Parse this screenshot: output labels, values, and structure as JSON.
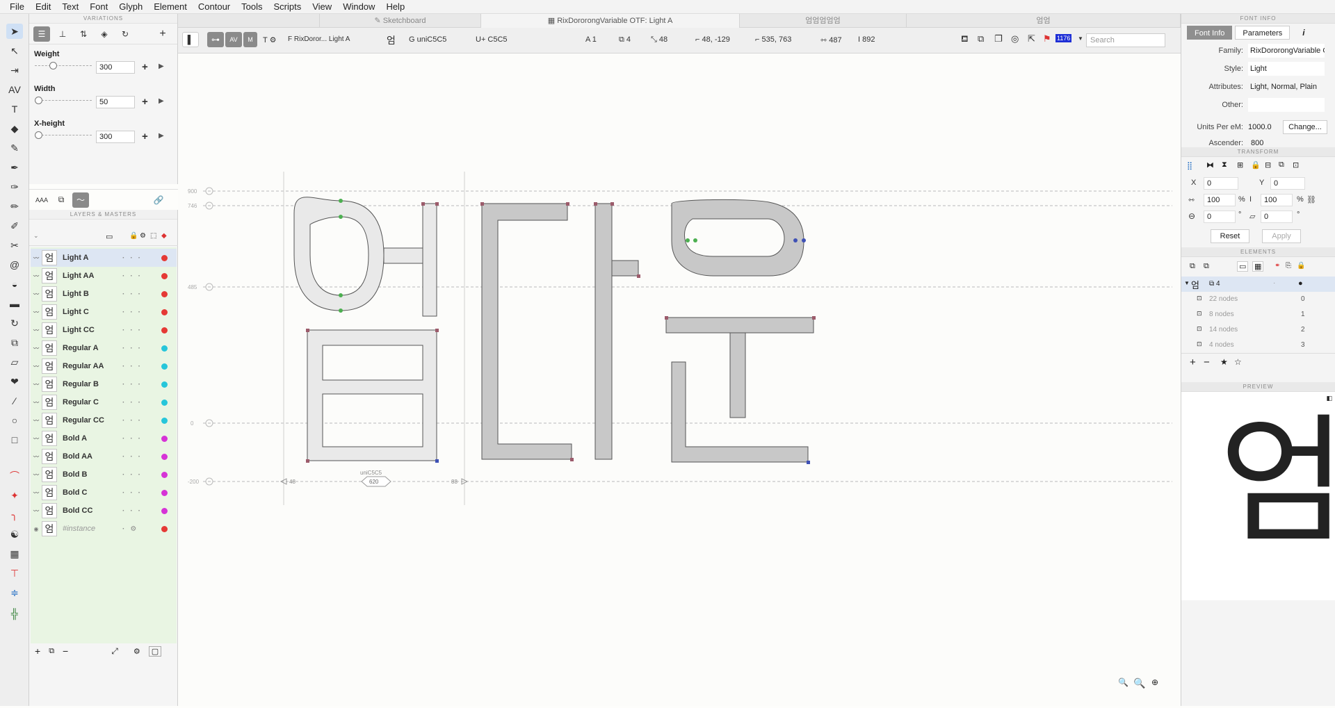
{
  "menu": [
    "File",
    "Edit",
    "Text",
    "Font",
    "Glyph",
    "Element",
    "Contour",
    "Tools",
    "Scripts",
    "View",
    "Window",
    "Help"
  ],
  "variations": {
    "title": "VARIATIONS",
    "axes": [
      {
        "name": "Weight",
        "value": "300",
        "thumb": 0.3
      },
      {
        "name": "Width",
        "value": "50",
        "thumb": 0.0
      },
      {
        "name": "X-height",
        "value": "300",
        "thumb": 0.0
      }
    ]
  },
  "layers": {
    "title": "LAYERS & MASTERS",
    "items": [
      {
        "name": "Light A",
        "glyph": "엄",
        "color": "#e53935"
      },
      {
        "name": "Light AA",
        "glyph": "엄",
        "color": "#e53935"
      },
      {
        "name": "Light B",
        "glyph": "엄",
        "color": "#e53935"
      },
      {
        "name": "Light C",
        "glyph": "엄",
        "color": "#e53935"
      },
      {
        "name": "Light CC",
        "glyph": "엄",
        "color": "#e53935"
      },
      {
        "name": "Regular A",
        "glyph": "엄",
        "color": "#26c6da"
      },
      {
        "name": "Regular AA",
        "glyph": "엄",
        "color": "#26c6da"
      },
      {
        "name": "Regular B",
        "glyph": "엄",
        "color": "#26c6da"
      },
      {
        "name": "Regular C",
        "glyph": "엄",
        "color": "#26c6da"
      },
      {
        "name": "Regular CC",
        "glyph": "엄",
        "color": "#26c6da"
      },
      {
        "name": "Bold A",
        "glyph": "엄",
        "color": "#d633d6"
      },
      {
        "name": "Bold AA",
        "glyph": "엄",
        "color": "#d633d6"
      },
      {
        "name": "Bold B",
        "glyph": "엄",
        "color": "#d633d6"
      },
      {
        "name": "Bold C",
        "glyph": "엄",
        "color": "#d633d6"
      },
      {
        "name": "Bold CC",
        "glyph": "엄",
        "color": "#d633d6"
      },
      {
        "name": "#instance",
        "glyph": "엄",
        "color": "#e53935"
      }
    ]
  },
  "tabs": {
    "sketchboard": "Sketchboard",
    "document": "RixDororongVariable OTF: Light A",
    "glyphs": "엄엄엄엄엄",
    "extra": "엄엄"
  },
  "info": {
    "font": "F RixDoror... Light A",
    "glyph": "G uniC5C5",
    "unicode": "U+ C5C5",
    "layer": "A 1",
    "contours": "4",
    "nodes": "48",
    "position": "48, -129",
    "size": "535, 763",
    "width": "487",
    "height": "892",
    "highlight": "1176",
    "search_placeholder": "Search"
  },
  "canvas": {
    "metric_labels": [
      "900",
      "746",
      "485",
      "0",
      "-200"
    ],
    "glyph_label": "uniC5C5",
    "advance": "620",
    "lsb": "48",
    "rsb": "88"
  },
  "font_info": {
    "title": "FONT INFO",
    "tab_font": "Font Info",
    "tab_params": "Parameters",
    "family_label": "Family:",
    "family": "RixDororongVariable OT",
    "style_label": "Style:",
    "style": "Light",
    "attr_label": "Attributes:",
    "attributes": "Light, Normal, Plain",
    "other_label": "Other:",
    "other": "",
    "upm_label": "Units Per eM:",
    "upm": "1000.0",
    "change": "Change...",
    "ascender_label": "Ascender:",
    "ascender": "800"
  },
  "transform": {
    "title": "TRANSFORM",
    "x": "0",
    "y": "0",
    "w": "100",
    "h": "100",
    "pct": "%",
    "rot": "0",
    "skew": "0",
    "deg": "°",
    "reset": "Reset",
    "apply": "Apply"
  },
  "elements": {
    "title": "ELEMENTS",
    "group": "4",
    "rows": [
      {
        "label": "22 nodes",
        "index": "0"
      },
      {
        "label": "8 nodes",
        "index": "1"
      },
      {
        "label": "14 nodes",
        "index": "2"
      },
      {
        "label": "4 nodes",
        "index": "3"
      }
    ]
  },
  "preview": {
    "title": "PREVIEW",
    "glyph": "엄"
  }
}
